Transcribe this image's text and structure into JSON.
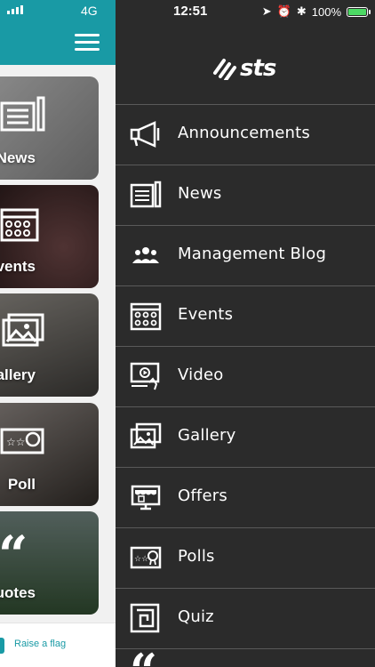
{
  "status": {
    "carrier": "4G",
    "time": "12:51",
    "battery_text": "100%",
    "battery_level": 1.0,
    "battery_color": "#4cd964"
  },
  "brand": {
    "logo_text": "sts",
    "header_color": "#199aa5",
    "drawer_bg": "#2b2b2b"
  },
  "tiles": [
    {
      "label": "News",
      "icon": "newspaper-icon",
      "bg": "#9a9a9a"
    },
    {
      "label": "Events",
      "icon": "calendar-icon",
      "bg": "#3d2a2a"
    },
    {
      "label": "Gallery",
      "icon": "gallery-icon",
      "bg": "#5d5a55"
    },
    {
      "label": "Poll",
      "icon": "poll-icon",
      "bg": "#4a4440"
    },
    {
      "label": "Quotes",
      "icon": "quote-icon",
      "bg": "#3f5a42"
    }
  ],
  "raise_flag": {
    "label": "Raise a flag"
  },
  "menu": [
    {
      "label": "Announcements",
      "icon": "megaphone-icon"
    },
    {
      "label": "News",
      "icon": "newspaper-icon"
    },
    {
      "label": "Management Blog",
      "icon": "group-icon"
    },
    {
      "label": "Events",
      "icon": "calendar-icon"
    },
    {
      "label": "Video",
      "icon": "video-icon"
    },
    {
      "label": "Gallery",
      "icon": "gallery-icon"
    },
    {
      "label": "Offers",
      "icon": "shop-icon"
    },
    {
      "label": "Polls",
      "icon": "poll-icon"
    },
    {
      "label": "Quiz",
      "icon": "maze-icon"
    }
  ],
  "partial_item_icon": "quote-icon"
}
